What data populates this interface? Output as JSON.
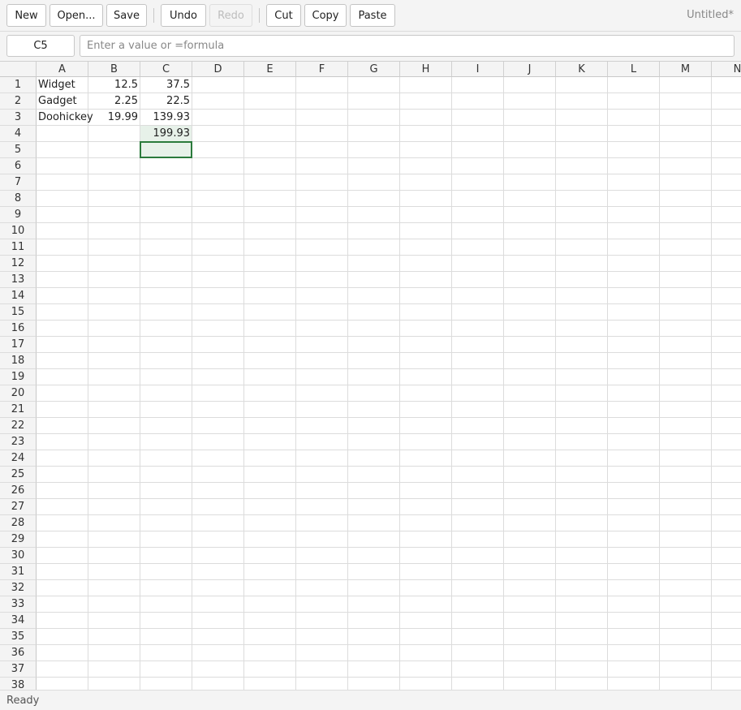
{
  "toolbar": {
    "new_label": "New",
    "open_label": "Open...",
    "save_label": "Save",
    "undo_label": "Undo",
    "redo_label": "Redo",
    "cut_label": "Cut",
    "copy_label": "Copy",
    "paste_label": "Paste",
    "document_title": "Untitled*"
  },
  "formula_bar": {
    "cell_reference": "C5",
    "formula_value": "",
    "formula_placeholder": "Enter a value or =formula"
  },
  "sheet": {
    "columns": [
      "A",
      "B",
      "C",
      "D",
      "E",
      "F",
      "G",
      "H",
      "I",
      "J",
      "K",
      "L",
      "M",
      "N"
    ],
    "rows": [
      "1",
      "2",
      "3",
      "4",
      "5",
      "6",
      "7",
      "8",
      "9",
      "10",
      "11",
      "12",
      "13",
      "14",
      "15",
      "16",
      "17",
      "18",
      "19",
      "20",
      "21",
      "22",
      "23",
      "24",
      "25",
      "26",
      "27",
      "28",
      "29",
      "30",
      "31",
      "32",
      "33",
      "34",
      "35",
      "36",
      "37",
      "38"
    ],
    "cells": [
      {
        "ref": "A1",
        "value": "Widget",
        "numeric": false
      },
      {
        "ref": "B1",
        "value": "12.5",
        "numeric": true
      },
      {
        "ref": "C1",
        "value": "37.5",
        "numeric": true
      },
      {
        "ref": "A2",
        "value": "Gadget",
        "numeric": false
      },
      {
        "ref": "B2",
        "value": "2.25",
        "numeric": true
      },
      {
        "ref": "C2",
        "value": "22.5",
        "numeric": true
      },
      {
        "ref": "A3",
        "value": "Doohickey",
        "numeric": false
      },
      {
        "ref": "B3",
        "value": "19.99",
        "numeric": true
      },
      {
        "ref": "C3",
        "value": "139.93",
        "numeric": true
      },
      {
        "ref": "C4",
        "value": "199.93",
        "numeric": true
      }
    ],
    "selected_cell": "C5",
    "highlighted_cells": [
      "C4"
    ]
  },
  "status_bar": {
    "status_text": "Ready"
  },
  "colors": {
    "selection_border": "#2b7a3c",
    "selection_fill": "#e7f1e9"
  }
}
